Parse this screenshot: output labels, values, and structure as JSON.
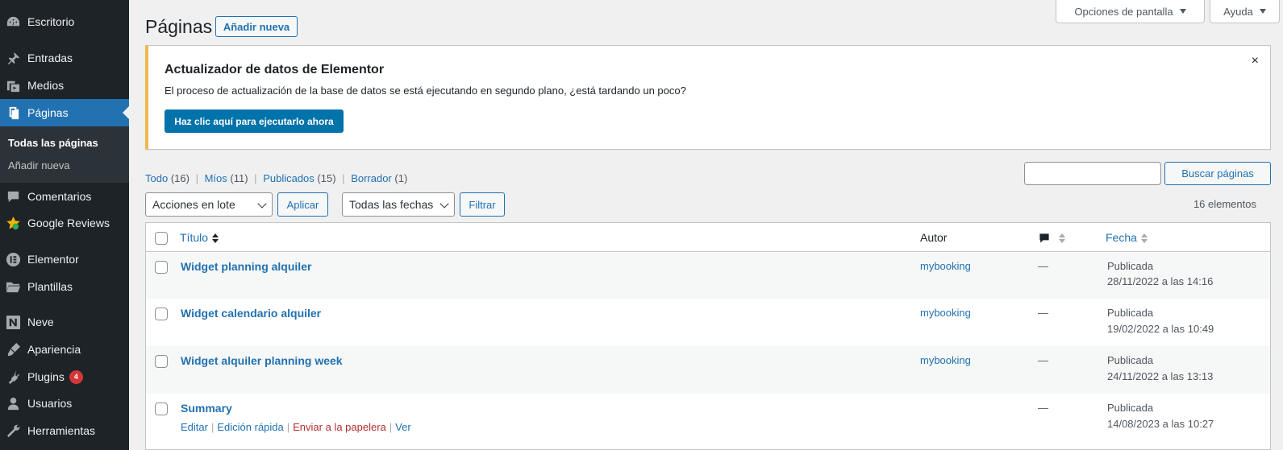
{
  "sidebar": {
    "items": [
      {
        "label": "Escritorio",
        "icon": "dashboard-icon"
      },
      {
        "label": "Entradas",
        "icon": "pin-icon"
      },
      {
        "label": "Medios",
        "icon": "media-icon"
      },
      {
        "label": "Páginas",
        "icon": "pages-icon"
      },
      {
        "label": "Comentarios",
        "icon": "comment-icon"
      },
      {
        "label": "Google Reviews",
        "icon": "star-icon"
      },
      {
        "label": "Elementor",
        "icon": "elementor-icon"
      },
      {
        "label": "Plantillas",
        "icon": "folder-icon"
      },
      {
        "label": "Neve",
        "icon": "neve-icon"
      },
      {
        "label": "Apariencia",
        "icon": "brush-icon"
      },
      {
        "label": "Plugins",
        "icon": "plugin-icon",
        "badge": "4"
      },
      {
        "label": "Usuarios",
        "icon": "user-icon"
      },
      {
        "label": "Herramientas",
        "icon": "wrench-icon"
      }
    ],
    "submenu": [
      "Todas las páginas",
      "Añadir nueva"
    ]
  },
  "header": {
    "title": "Páginas",
    "add_new": "Añadir nueva",
    "screen_options": "Opciones de pantalla",
    "help": "Ayuda"
  },
  "notice": {
    "title": "Actualizador de datos de Elementor",
    "text": "El proceso de actualización de la base de datos se está ejecutando en segundo plano, ¿está tardando un poco?",
    "button": "Haz clic aquí para ejecutarlo ahora",
    "close": "×"
  },
  "filters": {
    "status_links": [
      {
        "label": "Todo",
        "count": "(16)"
      },
      {
        "label": "Míos",
        "count": "(11)"
      },
      {
        "label": "Publicados",
        "count": "(15)"
      },
      {
        "label": "Borrador",
        "count": "(1)"
      }
    ],
    "search_button": "Buscar páginas",
    "bulk_actions": "Acciones en lote",
    "apply": "Aplicar",
    "all_dates": "Todas las fechas",
    "filter": "Filtrar",
    "items_count": "16 elementos"
  },
  "table": {
    "columns": {
      "title": "Título",
      "author": "Autor",
      "date": "Fecha"
    },
    "rows": [
      {
        "title": "Widget planning alquiler",
        "author": "mybooking",
        "comments": "—",
        "status": "Publicada",
        "date": "28/11/2022 a las 14:16"
      },
      {
        "title": "Widget calendario alquiler",
        "author": "mybooking",
        "comments": "—",
        "status": "Publicada",
        "date": "19/02/2022 a las 10:49"
      },
      {
        "title": "Widget alquiler planning week",
        "author": "mybooking",
        "comments": "—",
        "status": "Publicada",
        "date": "24/11/2022 a las 13:13"
      },
      {
        "title": "Summary",
        "author": "",
        "comments": "—",
        "status": "Publicada",
        "date": "14/08/2023 a las 10:27",
        "actions": [
          "Editar",
          "Edición rápida",
          "Enviar a la papelera",
          "Ver"
        ]
      }
    ]
  },
  "colors": {
    "sidebar_bg": "#1d2327",
    "accent": "#2271b1",
    "notice_border": "#f0b849",
    "badge": "#d63638",
    "trash": "#b32d2e"
  }
}
